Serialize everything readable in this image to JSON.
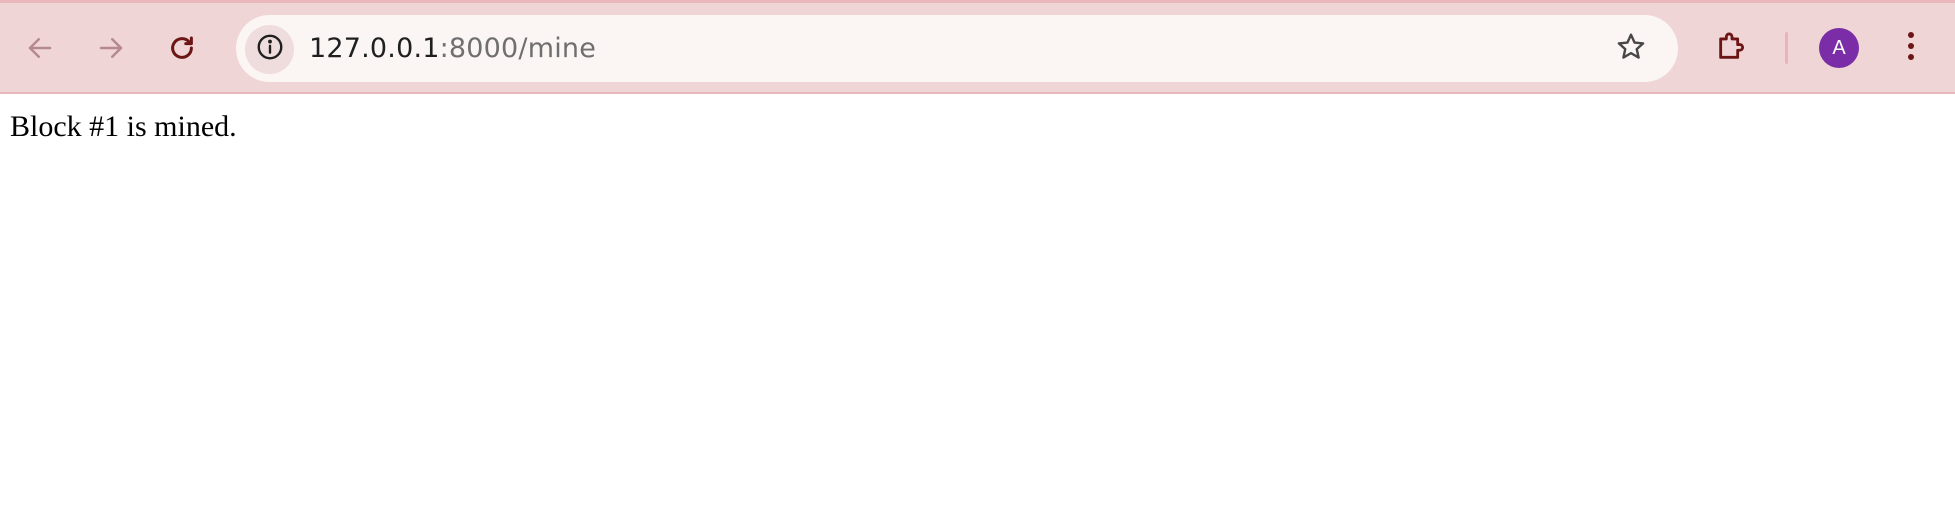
{
  "browser": {
    "url_host": "127.0.0.1",
    "url_path": ":8000/mine",
    "avatar_initial": "A",
    "icons": {
      "back": "arrow-left-icon",
      "forward": "arrow-right-icon",
      "reload": "reload-icon",
      "site_info": "info-icon",
      "bookmark": "star-outline-icon",
      "extensions": "puzzle-piece-icon",
      "menu": "vertical-ellipsis-icon"
    },
    "colors": {
      "toolbar_background": "#f0d5d6",
      "omnibox_background": "#fbf5f4",
      "avatar_background": "#7a2da6",
      "icon_color": "#6b1515"
    }
  },
  "page": {
    "message": "Block #1 is mined."
  }
}
